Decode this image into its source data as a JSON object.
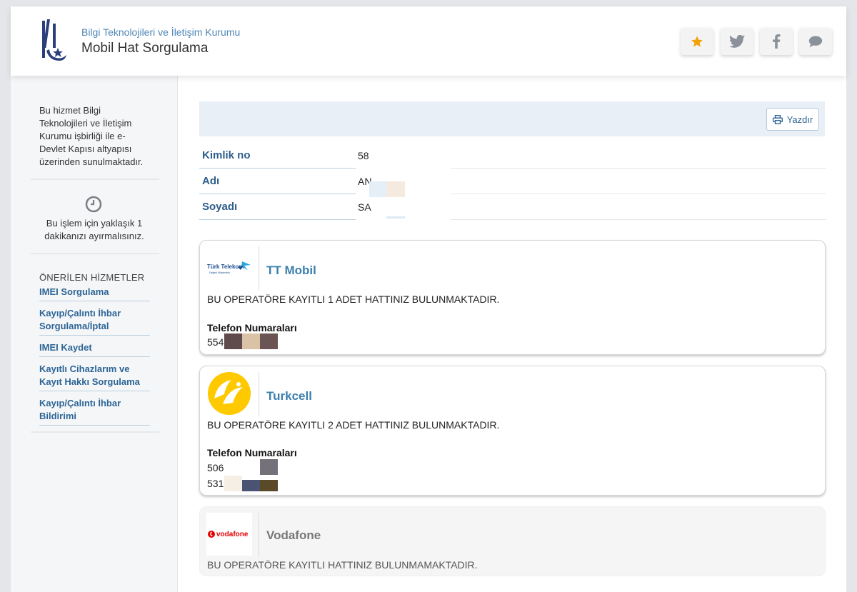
{
  "header": {
    "org": "Bilgi Teknolojileri ve İletişim Kurumu",
    "title": "Mobil Hat Sorgulama",
    "buttons": [
      "star-icon",
      "twitter-icon",
      "facebook-icon",
      "comment-icon"
    ],
    "star_color": "#f0a30a",
    "icon_color": "#8a9199"
  },
  "sidebar": {
    "info_text": "Bu hizmet Bilgi Teknolojileri ve İletişim Kurumu işbirliği ile e-Devlet Kapısı altyapısı üzerinden sunulmaktadır.",
    "time_text": "Bu işlem için yaklaşık 1 dakikanızı ayırmalısınız.",
    "recommended_title": "ÖNERİLEN HİZMETLER",
    "links": [
      "IMEI Sorgulama",
      "Kayıp/Çalıntı İhbar Sorgulama/İptal",
      "IMEI Kaydet",
      "Kayıtlı Cihazlarım ve Kayıt Hakkı Sorgulama",
      "Kayıp/Çalıntı İhbar Bildirimi"
    ]
  },
  "toolbar": {
    "print_label": "Yazdır"
  },
  "info": [
    {
      "label": "Kimlik no",
      "value": "58"
    },
    {
      "label": "Adı",
      "value": "AN"
    },
    {
      "label": "Soyadı",
      "value": "SA"
    }
  ],
  "operators": [
    {
      "name": "TT Mobil",
      "logo_text": "Türk Telekom",
      "logo_subtext": "Değerli Müşterimiz",
      "message": "BU OPERATÖRE KAYITLI 1 ADET HATTINIZ BULUNMAKTADIR.",
      "phones_title": "Telefon Numaraları",
      "phones": [
        "554"
      ]
    },
    {
      "name": "Turkcell",
      "message": "BU OPERATÖRE KAYITLI 2 ADET HATTINIZ BULUNMAKTADIR.",
      "phones_title": "Telefon Numaraları",
      "phones": [
        "506",
        "531"
      ]
    },
    {
      "name": "Vodafone",
      "logo_text": "vodafone",
      "message": "BU OPERATÖRE KAYITLI HATTINIZ BULUNMAMAKTADIR."
    }
  ],
  "colors": {
    "accent": "#2d6596",
    "operator_name": "#3c7fae",
    "turkcell_yellow": "#ffc900",
    "vodafone_red": "#e60000",
    "tt_blue": "#1d4f91"
  }
}
